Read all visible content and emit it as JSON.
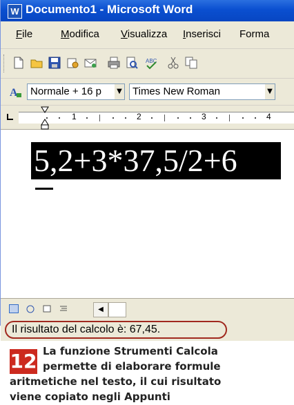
{
  "window": {
    "title": "Documento1 - Microsoft Word",
    "app_icon": "W"
  },
  "menubar": {
    "items": [
      {
        "mnemonic": "F",
        "rest": "ile"
      },
      {
        "mnemonic": "M",
        "rest": "odifica"
      },
      {
        "mnemonic": "V",
        "rest": "isualizza"
      },
      {
        "mnemonic": "I",
        "rest": "nserisci"
      },
      {
        "mnemonic": "",
        "rest": "Forma"
      }
    ]
  },
  "toolbar": {
    "icons": [
      "new-icon",
      "open-icon",
      "save-icon",
      "permission-icon",
      "email-icon",
      "print-icon",
      "print-preview-icon",
      "spellcheck-icon",
      "cut-icon",
      "copy-icon"
    ]
  },
  "formatting": {
    "style_value": "Normale + 16 p",
    "font_value": "Times New Roman"
  },
  "ruler": {
    "labels": [
      "1",
      "2",
      "3",
      "4"
    ]
  },
  "document": {
    "formula": "5,2+3*37,5/2+6"
  },
  "statusbar": {
    "text": "Il risultato del calcolo è: 67,45."
  },
  "caption": {
    "number": "12",
    "lines": [
      "La funzione Strumenti Calcola",
      "permette di elaborare formule",
      "aritmetiche nel testo, il cui risultato",
      "viene copiato negli Appunti"
    ]
  },
  "colors": {
    "title_blue": "#0a4fd0",
    "highlight_red": "#a0281e",
    "caption_red": "#cc2a1f"
  }
}
